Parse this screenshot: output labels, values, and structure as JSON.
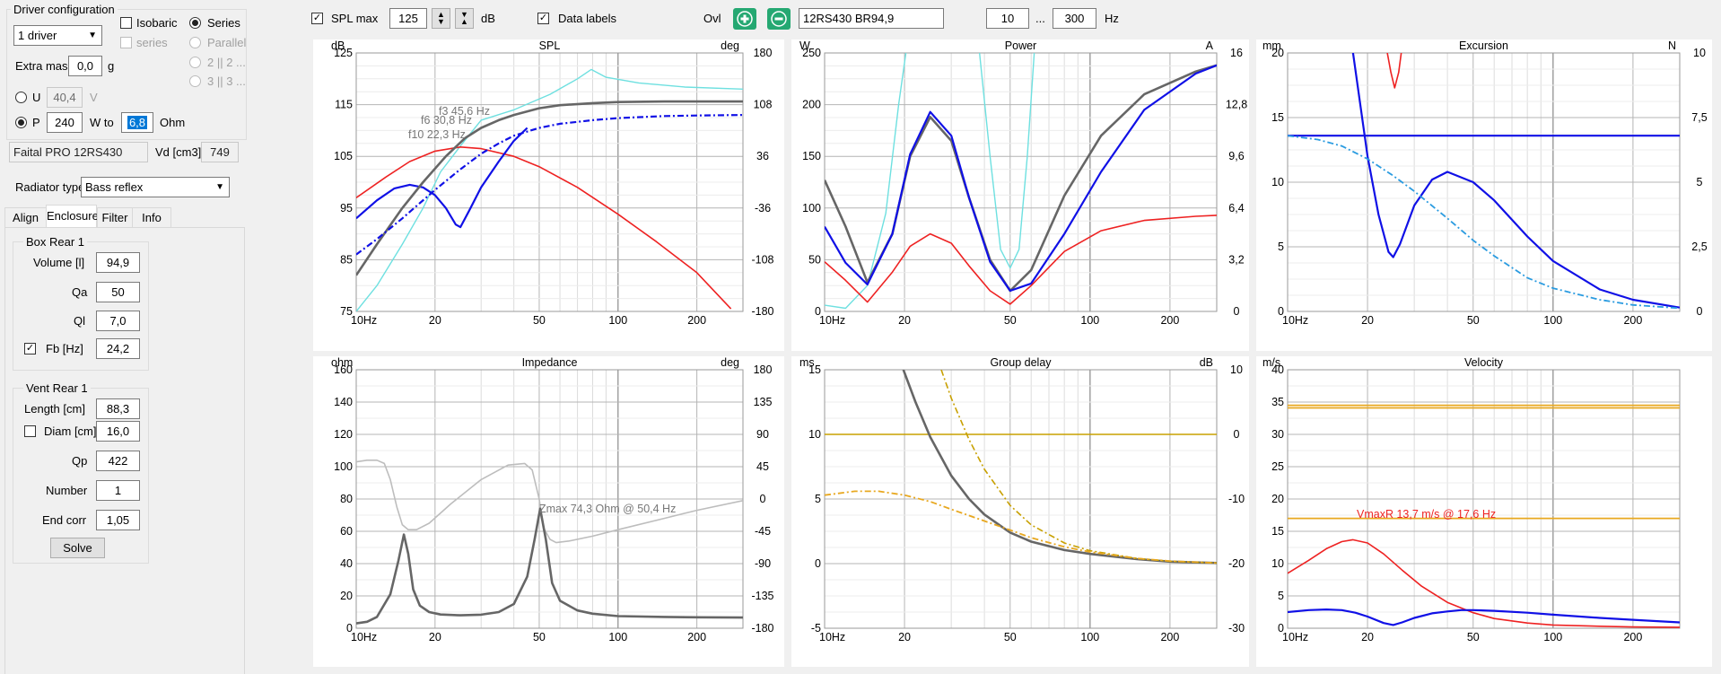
{
  "left_panel": {
    "driver_config": {
      "title": "Driver configuration",
      "driver_count": "1 driver",
      "isobaric_label": "Isobaric",
      "series_label": "Series",
      "series_dis_label": "series",
      "parallel_label": "Parallel",
      "opt_2p2": "2 || 2 ...",
      "opt_3p3": "3 || 3 ...",
      "extra_mass_label": "Extra mass",
      "extra_mass_value": "0,0",
      "extra_mass_unit": "g",
      "u_label": "U",
      "u_value": "40,4",
      "u_unit": "V",
      "p_label": "P",
      "p_value": "240",
      "w_to_label": "W to",
      "ohm_value": "6,8",
      "ohm_unit": "Ohm",
      "driver_name": "Faital PRO 12RS430",
      "vd_label": "Vd [cm3]",
      "vd_value": "749"
    },
    "radiator_label": "Radiator type",
    "radiator_value": "Bass reflex",
    "tabs": [
      "Align",
      "Enclosure",
      "Filter",
      "Info"
    ],
    "box": {
      "title": "Box Rear 1",
      "volume_label": "Volume [l]",
      "volume_value": "94,9",
      "qa_label": "Qa",
      "qa_value": "50",
      "ql_label": "Ql",
      "ql_value": "7,0",
      "fb_label": "Fb [Hz]",
      "fb_value": "24,2"
    },
    "vent": {
      "title": "Vent Rear 1",
      "length_label": "Length [cm]",
      "length_value": "88,3",
      "diam_label": "Diam [cm]",
      "diam_value": "16,0",
      "qp_label": "Qp",
      "qp_value": "422",
      "number_label": "Number",
      "number_value": "1",
      "endcorr_label": "End corr",
      "endcorr_value": "1,05",
      "solve_label": "Solve"
    }
  },
  "toolbar": {
    "splmax_label": "SPL max",
    "splmax_value": "125",
    "db_unit": "dB",
    "datalabels_label": "Data labels",
    "ovl_label": "Ovl",
    "overlay_name": "12RS430 BR94,9",
    "freq_min": "10",
    "freq_sep": "...",
    "freq_max": "300",
    "hz_unit": "Hz"
  },
  "colors": {
    "grid": "#b4b4b4",
    "minor_grid": "#dcdcdc",
    "red": "#ee2222",
    "blue": "#1010e6",
    "gray": "#666666",
    "cyan": "#6ee0e0",
    "orange": "#e8a820",
    "olive": "#c8a000"
  },
  "chart_data": [
    {
      "id": "spl",
      "type": "line",
      "title": "SPL",
      "ylabel": "dB",
      "y2label": "deg",
      "x_scale": "log",
      "xlim": [
        10,
        300
      ],
      "ylim": [
        75,
        125
      ],
      "y2lim": [
        -180,
        180
      ],
      "x_ticks": [
        "10Hz",
        "20",
        "50",
        "100",
        "200"
      ],
      "y_ticks": [
        "125",
        "115",
        "105",
        "95",
        "85",
        "75"
      ],
      "y2_ticks": [
        "180",
        "108",
        "36",
        "-36",
        "-108",
        "-180"
      ],
      "annotations": [
        "f3 45,6 Hz",
        "f6 30,8 Hz",
        "f10 22,3 Hz"
      ],
      "series": [
        {
          "color": "cyan",
          "axis": "y",
          "x": [
            10,
            12,
            15,
            18,
            21,
            25,
            30,
            40,
            55,
            70,
            79,
            90,
            120,
            180,
            300
          ],
          "y": [
            75,
            80,
            88,
            95,
            102,
            107,
            112,
            114,
            117,
            120,
            121.8,
            120.3,
            119.2,
            118.4,
            118
          ]
        },
        {
          "color": "red",
          "axis": "y",
          "x": [
            10,
            13,
            16,
            20,
            25,
            30,
            40,
            50,
            70,
            100,
            140,
            200,
            270
          ],
          "y": [
            97,
            101,
            104,
            106,
            106.8,
            106.5,
            105,
            103,
            99,
            93.8,
            88.5,
            82.5,
            75.5
          ]
        },
        {
          "color": "blue",
          "axis": "y",
          "x": [
            10,
            12,
            14,
            16,
            18,
            20,
            22,
            24,
            25,
            27,
            30,
            35,
            40,
            45
          ],
          "y": [
            93,
            96.5,
            98.8,
            99.5,
            99,
            97.5,
            95,
            91.8,
            91.3,
            94.5,
            99,
            104,
            108,
            110.5
          ]
        },
        {
          "color": "gray",
          "axis": "y",
          "x": [
            10,
            12,
            15,
            18,
            22,
            26,
            30,
            35,
            40,
            50,
            60,
            80,
            100,
            150,
            300
          ],
          "y": [
            82,
            88,
            95,
            100,
            105,
            108.5,
            110.5,
            112,
            113,
            114.3,
            114.9,
            115.3,
            115.5,
            115.6,
            115.6
          ]
        },
        {
          "color": "blue",
          "dash": true,
          "axis": "y",
          "x": [
            10,
            12,
            15,
            20,
            25,
            30,
            35,
            40,
            50,
            60,
            80,
            100,
            150,
            200,
            300
          ],
          "y": [
            86,
            89,
            93,
            98.5,
            102.5,
            105.5,
            107.5,
            109,
            110.5,
            111.3,
            112,
            112.4,
            112.8,
            112.9,
            113
          ]
        }
      ]
    },
    {
      "id": "power",
      "type": "line",
      "title": "Power",
      "ylabel": "W",
      "y2label": "A",
      "x_scale": "log",
      "xlim": [
        10,
        300
      ],
      "ylim": [
        0,
        250
      ],
      "y2lim": [
        0,
        16
      ],
      "x_ticks": [
        "10Hz",
        "20",
        "50",
        "100",
        "200"
      ],
      "y_ticks": [
        "250",
        "200",
        "150",
        "100",
        "50",
        "0"
      ],
      "y2_ticks": [
        "16",
        "12,8",
        "9,6",
        "6,4",
        "3,2",
        "0"
      ],
      "series": [
        {
          "color": "cyan",
          "axis": "y",
          "x": [
            10,
            12,
            14.5,
            17,
            19,
            20.5
          ],
          "y": [
            6,
            3,
            25,
            95,
            200,
            260
          ]
        },
        {
          "color": "cyan",
          "axis": "y",
          "x": [
            38,
            42,
            46,
            50,
            54,
            58,
            62
          ],
          "y": [
            260,
            150,
            60,
            42,
            60,
            150,
            260
          ]
        },
        {
          "color": "gray",
          "axis": "y",
          "x": [
            10,
            12,
            14.5,
            18,
            21,
            25,
            30,
            35,
            42,
            50,
            60,
            80,
            110,
            160,
            250,
            300
          ],
          "y": [
            127,
            82,
            28,
            75,
            150,
            188,
            165,
            110,
            50,
            20,
            40,
            112,
            170,
            210,
            232,
            238
          ]
        },
        {
          "color": "blue",
          "axis": "y",
          "x": [
            10,
            12,
            14.5,
            18,
            21,
            25,
            30,
            35,
            42,
            50,
            60,
            80,
            110,
            160,
            250,
            300
          ],
          "y": [
            82,
            47,
            26,
            75,
            152,
            193,
            170,
            110,
            48,
            20,
            27,
            75,
            135,
            195,
            230,
            238
          ]
        },
        {
          "color": "red",
          "axis": "y",
          "x": [
            10,
            12,
            14.5,
            18,
            21,
            25,
            30,
            35,
            42,
            50,
            60,
            80,
            110,
            160,
            250,
            300
          ],
          "y": [
            48,
            30,
            9,
            38,
            63,
            75,
            66,
            44,
            20,
            7,
            25,
            58,
            78,
            88,
            92,
            93
          ]
        }
      ]
    },
    {
      "id": "excursion",
      "type": "line",
      "title": "Excursion",
      "ylabel": "mm",
      "y2label": "N",
      "x_scale": "log",
      "xlim": [
        10,
        300
      ],
      "ylim": [
        0,
        20
      ],
      "y2lim": [
        0,
        10
      ],
      "x_ticks": [
        "10Hz",
        "20",
        "50",
        "100",
        "200"
      ],
      "y_ticks": [
        "20",
        "15",
        "10",
        "5",
        "0"
      ],
      "y2_ticks": [
        "10",
        "7,5",
        "5",
        "2,5",
        "0"
      ],
      "series": [
        {
          "color": "red",
          "axis": "y",
          "x": [
            23.5,
            24.5,
            25.3,
            26.2,
            27
          ],
          "y": [
            20.5,
            18.5,
            17.3,
            18.5,
            20.5
          ]
        },
        {
          "color": "blue",
          "axis": "y",
          "x": [
            10,
            300
          ],
          "y": [
            13.6,
            13.6
          ]
        },
        {
          "color": "blue",
          "axis": "y",
          "x": [
            17.5,
            20,
            22,
            24,
            25,
            26.5,
            30,
            35,
            40,
            50,
            60,
            80,
            100,
            150,
            200,
            300
          ],
          "y": [
            20.5,
            12,
            7.5,
            4.6,
            4.2,
            5.2,
            8.2,
            10.2,
            10.8,
            10,
            8.6,
            5.8,
            3.9,
            1.7,
            0.9,
            0.3
          ]
        },
        {
          "color": "cyan2",
          "dash": true,
          "axis": "y",
          "x": [
            10,
            13,
            16,
            20,
            25,
            30,
            40,
            50,
            60,
            80,
            100,
            150,
            200,
            300
          ],
          "y": [
            13.6,
            13.3,
            12.8,
            11.8,
            10.5,
            9.3,
            7.2,
            5.5,
            4.3,
            2.6,
            1.8,
            0.9,
            0.5,
            0.25
          ]
        }
      ]
    },
    {
      "id": "impedance",
      "type": "line",
      "title": "Impedance",
      "ylabel": "ohm",
      "y2label": "deg",
      "x_scale": "log",
      "xlim": [
        10,
        300
      ],
      "ylim": [
        0,
        160
      ],
      "y2lim": [
        -180,
        180
      ],
      "x_ticks": [
        "10Hz",
        "20",
        "50",
        "100",
        "200"
      ],
      "y_ticks": [
        "160",
        "140",
        "120",
        "100",
        "80",
        "60",
        "40",
        "20",
        "0"
      ],
      "y2_ticks": [
        "180",
        "135",
        "90",
        "45",
        "0",
        "-45",
        "-90",
        "-135",
        "-180"
      ],
      "annotations": [
        "Zmax 74,3 Ohm @ 50,4 Hz"
      ],
      "series": [
        {
          "color": "lightgray",
          "axis": "y",
          "x": [
            10,
            11,
            12,
            12.8,
            13.5,
            14.3,
            15,
            15.8,
            17,
            19,
            23,
            30,
            38,
            44,
            47,
            50,
            52,
            55,
            58,
            65,
            80,
            100,
            150,
            200,
            300
          ],
          "y": [
            103,
            104,
            104,
            102,
            92,
            75,
            64,
            61,
            61,
            65,
            77,
            92,
            101,
            102,
            98,
            80,
            62,
            55,
            53,
            54,
            57,
            61,
            68,
            73,
            79
          ]
        },
        {
          "color": "gray",
          "axis": "y",
          "x": [
            10,
            11,
            12,
            13.5,
            14.5,
            15.2,
            15.8,
            16.5,
            17.5,
            19,
            21,
            25,
            30,
            35,
            40,
            45,
            48,
            50.4,
            53,
            56,
            60,
            70,
            80,
            100,
            150,
            200,
            300
          ],
          "y": [
            3,
            4,
            7,
            21,
            42,
            58,
            46,
            24,
            14,
            10,
            8.5,
            8,
            8.4,
            10,
            15,
            32,
            55,
            74,
            55,
            28,
            17,
            11,
            9,
            7.5,
            7,
            6.8,
            6.6
          ]
        }
      ]
    },
    {
      "id": "group_delay",
      "type": "line",
      "title": "Group delay",
      "ylabel": "ms",
      "y2label": "dB",
      "x_scale": "log",
      "xlim": [
        10,
        300
      ],
      "ylim": [
        -5,
        15
      ],
      "y2lim": [
        -30,
        10
      ],
      "x_ticks": [
        "10Hz",
        "20",
        "50",
        "100",
        "200"
      ],
      "y_ticks": [
        "15",
        "10",
        "5",
        "0",
        "-5"
      ],
      "y2_ticks": [
        "10",
        "0",
        "-10",
        "-20",
        "-30"
      ],
      "series": [
        {
          "color": "olive",
          "axis": "y",
          "x": [
            10,
            300
          ],
          "y": [
            10,
            10
          ]
        },
        {
          "color": "gray",
          "axis": "y",
          "x": [
            19.8,
            22,
            25,
            30,
            35,
            40,
            50,
            60,
            80,
            100,
            150,
            200,
            300
          ],
          "y": [
            15,
            12.5,
            9.8,
            6.8,
            5,
            3.8,
            2.4,
            1.7,
            1.05,
            0.75,
            0.35,
            0.15,
            0.05
          ]
        },
        {
          "color": "olive",
          "dash": true,
          "axis": "y",
          "x": [
            27.5,
            30,
            35,
            40,
            50,
            60,
            80,
            100,
            150,
            200,
            300
          ],
          "y": [
            15,
            12.8,
            9.6,
            7.3,
            4.5,
            3,
            1.6,
            1,
            0.4,
            0.18,
            0.05
          ]
        },
        {
          "color": "orange",
          "dash": true,
          "axis": "y",
          "x": [
            10,
            13,
            16,
            20,
            25,
            30,
            40,
            50,
            60,
            80,
            100,
            150,
            200,
            300
          ],
          "y": [
            5.3,
            5.6,
            5.6,
            5.3,
            4.8,
            4.2,
            3.3,
            2.6,
            2,
            1.3,
            0.9,
            0.4,
            0.2,
            0.05
          ]
        }
      ]
    },
    {
      "id": "velocity",
      "type": "line",
      "title": "Velocity",
      "ylabel": "m/s",
      "x_scale": "log",
      "xlim": [
        10,
        300
      ],
      "ylim": [
        0,
        40
      ],
      "x_ticks": [
        "10Hz",
        "20",
        "50",
        "100",
        "200"
      ],
      "y_ticks": [
        "40",
        "35",
        "30",
        "25",
        "20",
        "15",
        "10",
        "5",
        "0"
      ],
      "annotations": [
        "VmaxR 13,7 m/s @ 17,6 Hz"
      ],
      "series": [
        {
          "color": "orange",
          "axis": "y",
          "x": [
            10,
            300
          ],
          "y": [
            34.5,
            34.5
          ]
        },
        {
          "color": "orange",
          "axis": "y",
          "x": [
            10,
            300
          ],
          "y": [
            34.1,
            34.1
          ]
        },
        {
          "color": "orange",
          "axis": "y",
          "x": [
            10,
            300
          ],
          "y": [
            17,
            17
          ]
        },
        {
          "color": "red",
          "axis": "y",
          "x": [
            10,
            12,
            14,
            16,
            17.6,
            20,
            23,
            27,
            32,
            40,
            50,
            60,
            80,
            100,
            150,
            200,
            300
          ],
          "y": [
            8.5,
            10.5,
            12.3,
            13.4,
            13.7,
            13.2,
            11.5,
            9,
            6.5,
            4,
            2.4,
            1.5,
            0.8,
            0.5,
            0.3,
            0.2,
            0.15
          ]
        },
        {
          "color": "blue",
          "axis": "y",
          "x": [
            10,
            12,
            14,
            16,
            18,
            20,
            23,
            25,
            27,
            30,
            35,
            40,
            45,
            50,
            60,
            80,
            100,
            150,
            200,
            300
          ],
          "y": [
            2.5,
            2.8,
            2.9,
            2.8,
            2.4,
            1.8,
            0.8,
            0.5,
            0.9,
            1.6,
            2.3,
            2.6,
            2.8,
            2.8,
            2.7,
            2.4,
            2.1,
            1.6,
            1.3,
            0.9
          ]
        }
      ]
    }
  ]
}
